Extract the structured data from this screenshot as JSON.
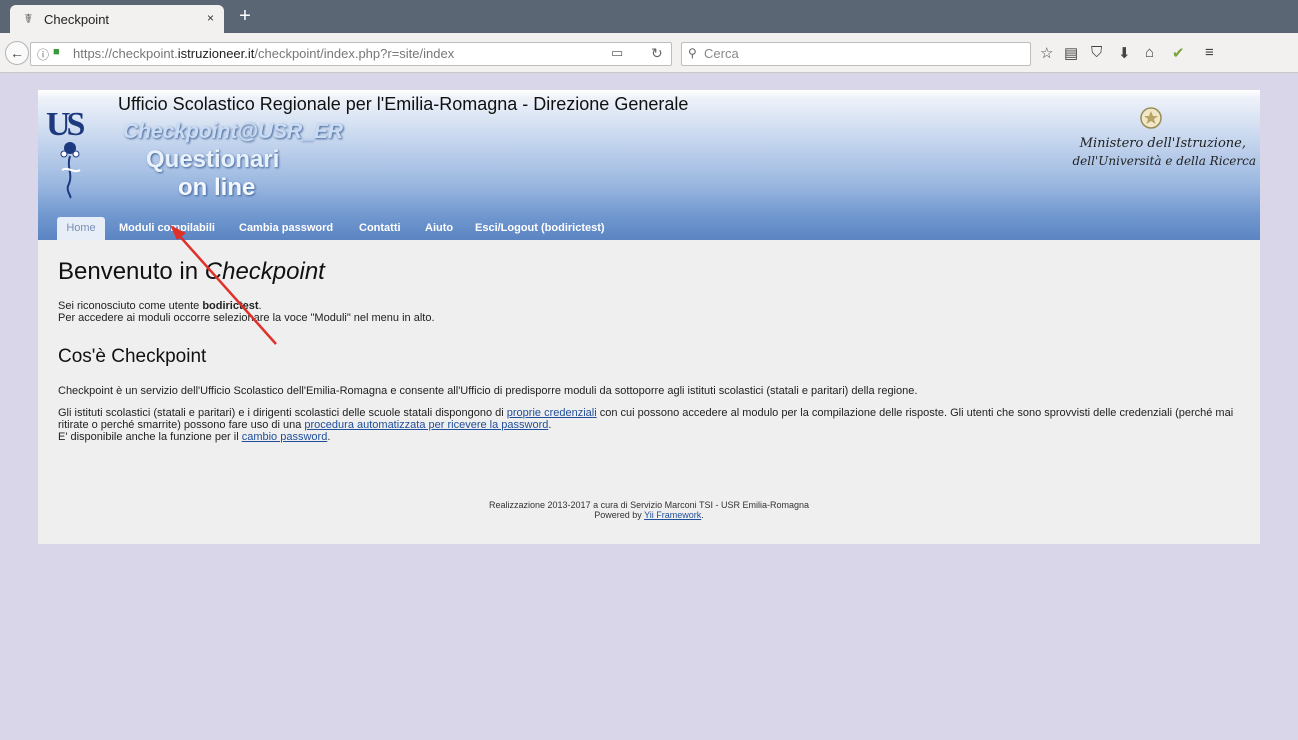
{
  "browser": {
    "tab_title": "Checkpoint",
    "tab_close": "×",
    "new_tab": "+",
    "url_prefix": "https://checkpoint.",
    "url_domain": "istruzioneer.it",
    "url_path": "/checkpoint/index.php?r=site/index",
    "search_placeholder": "Cerca"
  },
  "header": {
    "title": "Ufficio Scolastico Regionale per l'Emilia-Romagna - Direzione Generale",
    "logo_text": "US",
    "logo_line1": "Checkpoint@USR_ER",
    "logo_line2": "Questionari",
    "logo_line3": "on line",
    "ministero_line1": "Ministero dell'Istruzione,",
    "ministero_line2": "dell'Università e della Ricerca"
  },
  "menu": {
    "home": "Home",
    "moduli": "Moduli compilabili",
    "password": "Cambia password",
    "contatti": "Contatti",
    "aiuto": "Aiuto",
    "esci": "Esci/Logout (bodirictest)"
  },
  "main": {
    "welcome_prefix": "Benvenuto in ",
    "welcome_name": "Checkpoint",
    "user_line_prefix": "Sei riconosciuto come utente ",
    "user_name": "bodirictest",
    "user_line_suffix": ".",
    "instructions": "Per accedere ai moduli occorre selezionare la voce \"Moduli\" nel menu in alto.",
    "section_title": "Cos'è Checkpoint",
    "description": "Checkpoint è un servizio dell'Ufficio Scolastico dell'Emilia-Romagna e consente all'Ufficio di predisporre moduli da sottoporre agli istituti scolastici (statali e paritari) della regione.",
    "cred_text1": "Gli istituti scolastici (statali e paritari) e i dirigenti scolastici delle scuole statali dispongono di ",
    "cred_link1": "proprie credenziali",
    "cred_text2": " con cui possono accedere al modulo per la compilazione delle risposte. Gli utenti che sono sprovvisti delle credenziali (perché mai ritirate o perché smarrite) possono fare uso di una ",
    "cred_link2": "procedura automatizzata per ricevere la password",
    "cred_text3": ".",
    "change_text": "E' disponibile anche la funzione per il ",
    "change_link": "cambio password",
    "change_end": "."
  },
  "footer": {
    "line1": "Realizzazione 2013-2017 a cura di Servizio Marconi TSI - USR Emilia-Romagna",
    "powered_prefix": "Powered by ",
    "powered_link": "Yii Framework",
    "powered_end": "."
  },
  "colors": {
    "annotation_arrow": "#e0302a",
    "menu_blue": "#5b84c2"
  }
}
